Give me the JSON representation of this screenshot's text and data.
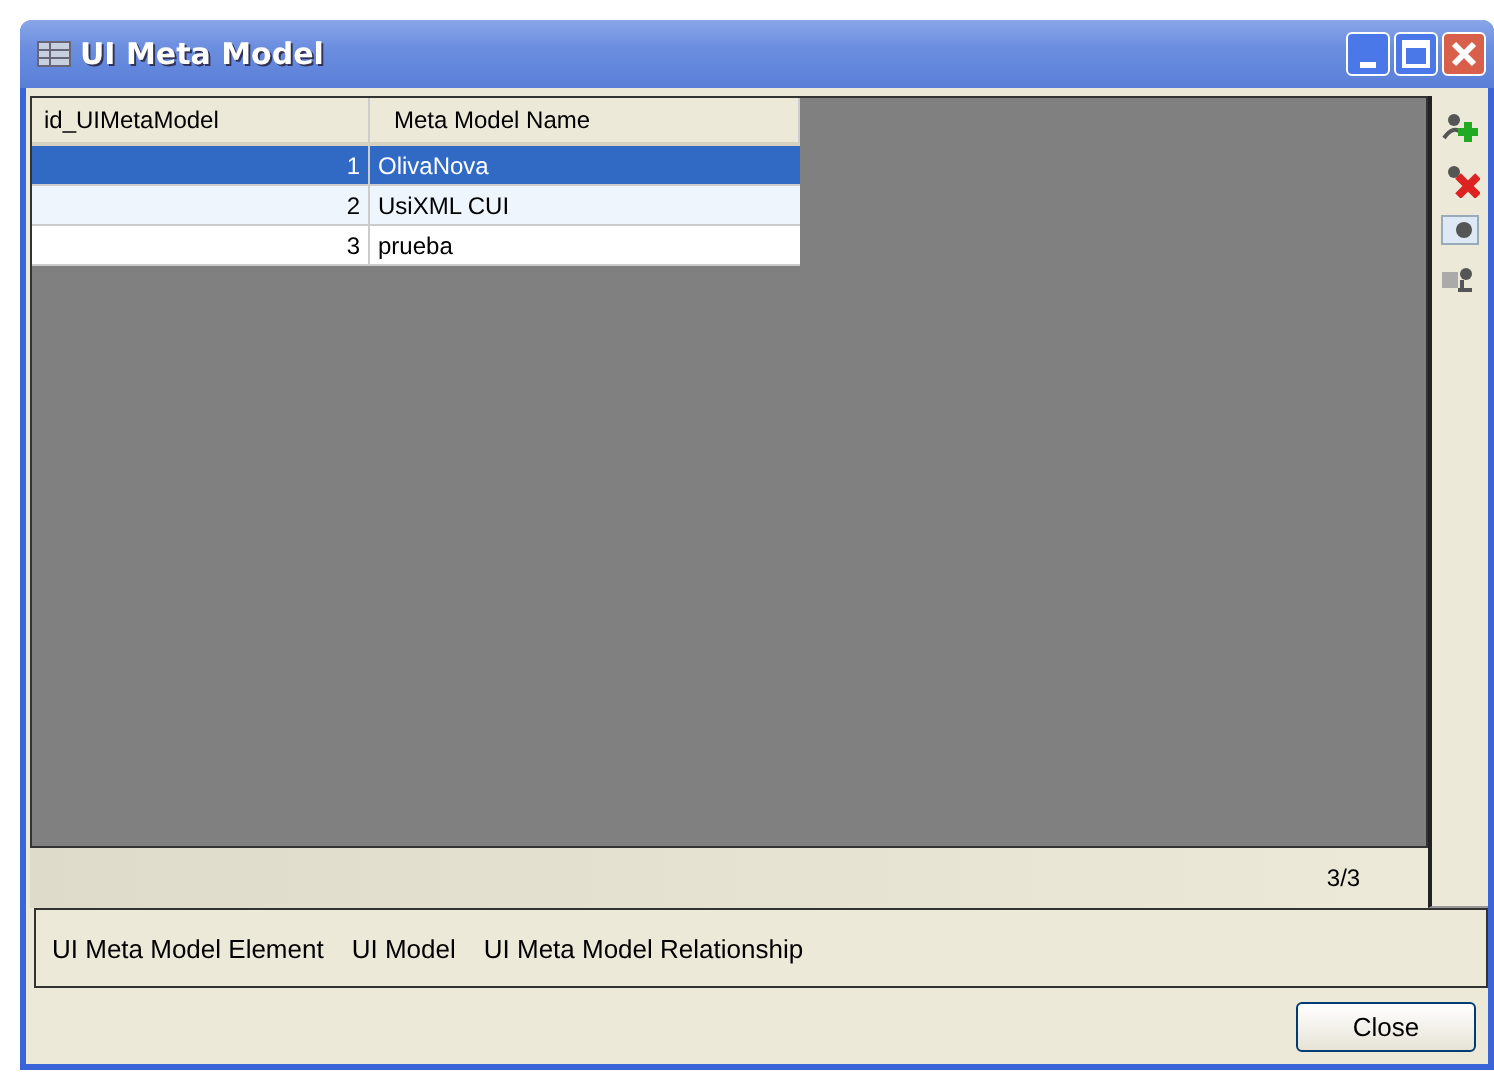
{
  "window": {
    "title": "UI Meta Model"
  },
  "table": {
    "columns": [
      "id_UIMetaModel",
      "Meta Model Name"
    ],
    "rows": [
      {
        "cells": [
          "1",
          "OlivaNova"
        ],
        "selected": true
      },
      {
        "cells": [
          "2",
          "UsiXML CUI"
        ],
        "selected": false
      },
      {
        "cells": [
          "3",
          "prueba"
        ],
        "selected": false
      }
    ]
  },
  "record_count": "3/3",
  "links": [
    "UI Meta Model Element",
    "UI Model",
    "UI Meta Model Relationship"
  ],
  "buttons": [
    "Close"
  ]
}
